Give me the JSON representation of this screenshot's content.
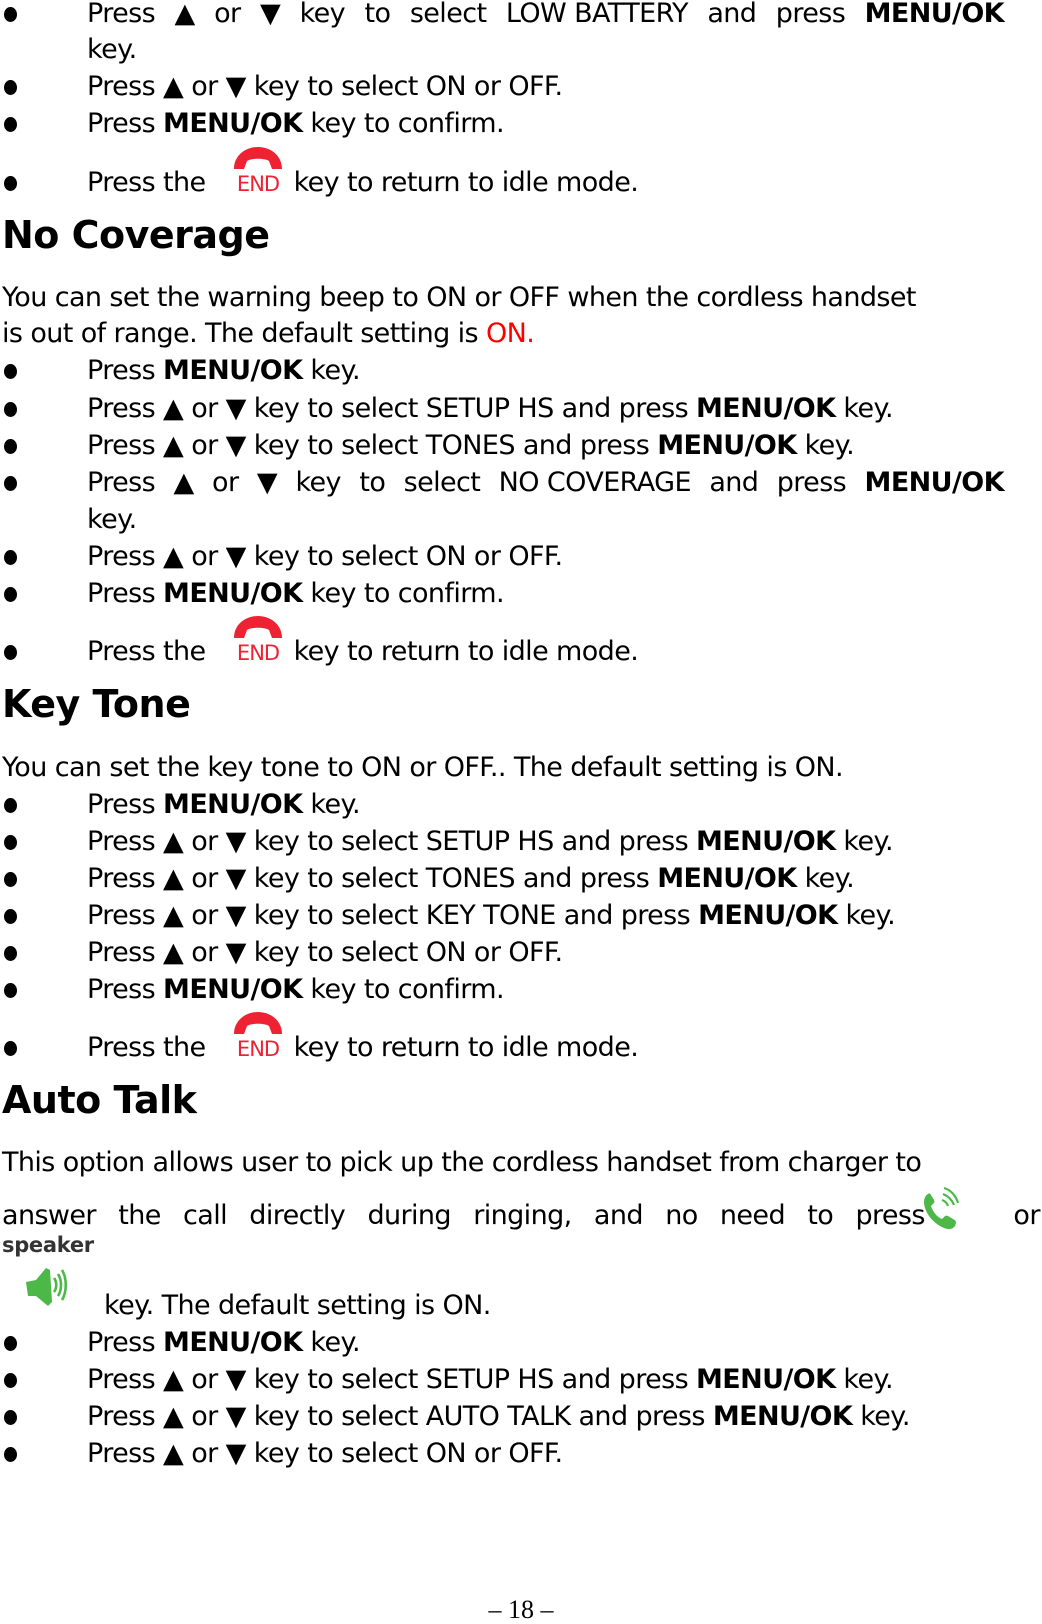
{
  "page_number": "– 18 –",
  "common": {
    "press": "Press",
    "press_the": "Press the",
    "or_word": "or",
    "menu_ok": "MENU/OK",
    "key_dot": "key.",
    "up_arrow": "▲",
    "down_arrow": "▼",
    "key_to_select": "key to select",
    "and_press": "and press",
    "key_to_confirm": "key to confirm.",
    "key_return_idle": "key to return to idle mode.",
    "select_on_off": "key to select ON or OFF.",
    "end_icon_label": "END",
    "end_icon_color": "#ee2233"
  },
  "top_section": {
    "step1_target": "LOW BATTERY",
    "step1_wrap": "key."
  },
  "no_coverage": {
    "title": "No Coverage",
    "intro_line1": "You can set the warning beep to ON or OFF when the cordless handset",
    "intro_line2_prefix": "is out of range. The default setting is",
    "intro_default": "ON.",
    "default_color": "#ff0000",
    "step_setup": "SETUP HS",
    "step_tones": "TONES",
    "step_item": "NO COVERAGE",
    "step_item_wrap": "key."
  },
  "key_tone": {
    "title": "Key Tone",
    "intro": "You can set the key tone to ON or OFF.. The default setting is ON.",
    "step_setup": "SETUP HS",
    "step_tones": "TONES",
    "step_item": "KEY TONE"
  },
  "auto_talk": {
    "title": "Auto Talk",
    "intro_line1": "This option allows user to pick up the cordless handset from charger to",
    "intro_line2": [
      "answer",
      "the",
      "call",
      "directly",
      "during",
      "ringing,",
      "and",
      "no",
      "need",
      "to",
      "press"
    ],
    "intro_or": "or",
    "speaker_label": "speaker",
    "intro_line3": "key. The default setting is ON.",
    "step_setup": "SETUP HS",
    "step_item": "AUTO TALK",
    "icon_color": "#4cb848"
  }
}
